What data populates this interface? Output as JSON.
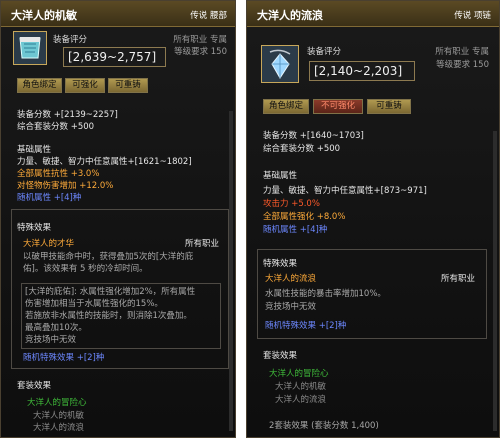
{
  "left": {
    "name": "大洋人的机敏",
    "tag": "传说 腰部",
    "score_label": "装备评分",
    "score_range": "[2,639~2,757]",
    "job": "所有职业 专属",
    "level": "等级要求 150",
    "buttons": [
      "角色绑定",
      "可强化",
      "可重铸"
    ],
    "gear_score": "装备分数 +[2139~2257]",
    "set_score": "综合套装分数 +500",
    "base_title": "基础属性",
    "base_lines": [
      "力量、敏捷、智力中任意属性+[1621~1802]",
      "全部属性抗性 +3.0%",
      "对怪物伤害增加 +12.0%"
    ],
    "random_line": "随机属性 +[4]种",
    "special_title": "特殊效果",
    "skill_name": "大洋人的才华",
    "skill_job": "所有职业",
    "skill_lines": [
      "以破甲技能命中时，获得叠加5次的[大洋的庇",
      "佑]。该效果有 5 秒的冷却时间。"
    ],
    "skill_lines2": [
      "[大洋的庇佑]: 水属性强化增加2%，所有属性",
      "伤害增加相当于水属性强化的15%。",
      "若施放非水属性的技能时，则消除1次叠加。",
      "最高叠加10次。",
      "竞技场中无效"
    ],
    "random_special": "随机特殊效果 +[2]种",
    "set_title": "套装效果",
    "set_name": "大洋人的冒险心",
    "set_items": [
      "大洋人的机敏",
      "大洋人的流浪"
    ]
  },
  "right": {
    "name": "大洋人的流浪",
    "tag": "传说 项链",
    "score_label": "装备评分",
    "score_range": "[2,140~2,203]",
    "job": "所有职业 专属",
    "level": "等级要求 150",
    "buttons": [
      "角色绑定",
      "不可强化",
      "可重铸"
    ],
    "gear_score": "装备分数 +[1640~1703]",
    "set_score": "综合套装分数 +500",
    "base_title": "基础属性",
    "base_lines": [
      "力量、敏捷、智力中任意属性+[873~971]",
      "攻击力 +5.0%",
      "全部属性强化 +8.0%"
    ],
    "random_line": "随机属性 +[4]种",
    "special_title": "特殊效果",
    "skill_name": "大洋人的流浪",
    "skill_job": "所有职业",
    "skill_lines": [
      "水属性技能的暴击率增加10%。",
      "竞技场中无效"
    ],
    "random_special": "随机特殊效果 +[2]种",
    "set_title": "套装效果",
    "set_name": "大洋人的冒险心",
    "set_items": [
      "大洋人的机敏",
      "大洋人的流浪"
    ],
    "set_bonus": "2套装效果 (套装分数 1,400)"
  }
}
